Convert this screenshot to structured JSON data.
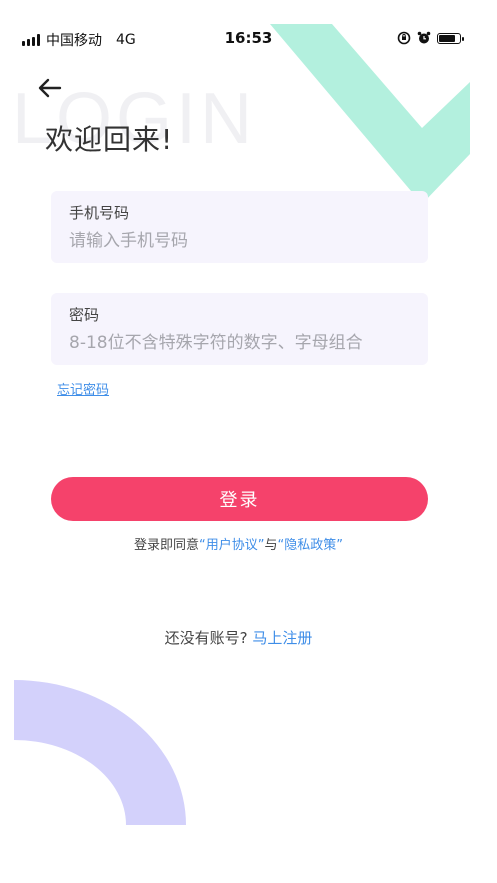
{
  "status_bar": {
    "carrier": "中国移动",
    "network": "4G",
    "time": "16:53"
  },
  "header": {
    "watermark": "LOGIN",
    "title": "欢迎回来!"
  },
  "phone_field": {
    "label": "手机号码",
    "placeholder": "请输入手机号码",
    "value": ""
  },
  "password_field": {
    "label": "密码",
    "placeholder": "8-18位不含特殊字符的数字、字母组合",
    "value": ""
  },
  "forgot_password": "忘记密码",
  "login_button": "登录",
  "agreement": {
    "prefix": "登录即同意",
    "user_agreement": "“用户协议”",
    "connector": "与",
    "privacy_policy": "“隐私政策”"
  },
  "register": {
    "prompt": "还没有账号?",
    "link": "马上注册"
  },
  "colors": {
    "accent_button": "#f5426b",
    "link": "#3f8ee8",
    "field_bg": "#f6f4fd",
    "deco_mint": "#b3f0de",
    "deco_lavender": "#d3d1fb"
  },
  "icons": {
    "back": "arrow-left-icon",
    "orientation_lock": "orientation-lock-icon",
    "alarm": "alarm-clock-icon",
    "battery": "battery-icon",
    "signal": "signal-bars-icon"
  }
}
